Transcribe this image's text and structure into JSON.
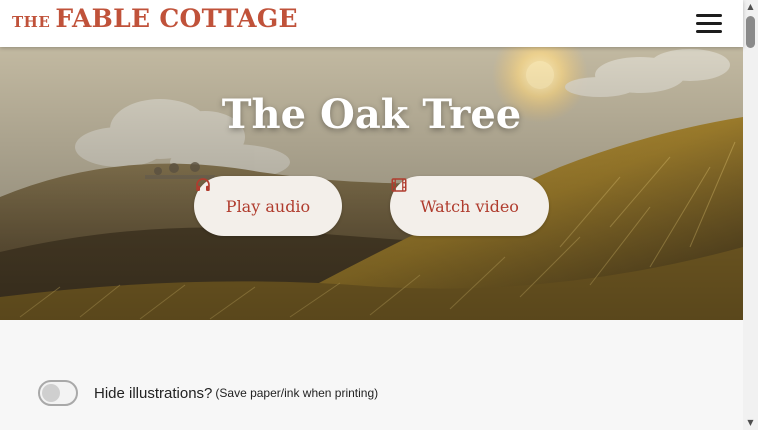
{
  "header": {
    "logo_prefix": "THE",
    "logo_main": "FABLE COTTAGE",
    "menu_icon": "hamburger-menu-icon"
  },
  "hero": {
    "title": "The Oak Tree",
    "play_audio_label": "Play audio",
    "play_audio_icon": "headphones-icon",
    "watch_video_label": "Watch video",
    "watch_video_icon": "film-icon"
  },
  "settings": {
    "hide_illustrations_label": "Hide illustrations?",
    "hide_illustrations_note": "(Save paper/ink when printing)",
    "hide_illustrations_on": false
  },
  "colors": {
    "brand": "#c0523a",
    "button_text": "#b03c2e",
    "button_bg": "#f3efea"
  }
}
